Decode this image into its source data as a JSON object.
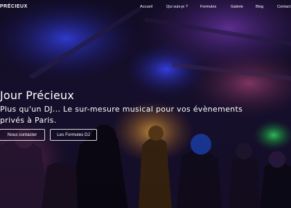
{
  "brand": {
    "name": "PRÉCIEUX"
  },
  "nav": {
    "items": [
      {
        "label": "Accueil"
      },
      {
        "label": "Qui suis-je ?"
      },
      {
        "label": "Formules"
      },
      {
        "label": "Galerie"
      },
      {
        "label": "Blog"
      },
      {
        "label": "Contact"
      }
    ]
  },
  "hero": {
    "title": "Jour Précieux",
    "subtitle": "Plus qu'un DJ... Le sur-mesure musical pour vos évènements privés à Paris.",
    "buttons": {
      "contact": "Nous contacter",
      "formules": "Les Formules DJ"
    }
  },
  "colors": {
    "background": "#0e0a1c",
    "stage_blue": "#2436ff",
    "stage_purple": "#6a2fae",
    "warm_light": "#c8892f",
    "green_light": "#21c94a"
  }
}
